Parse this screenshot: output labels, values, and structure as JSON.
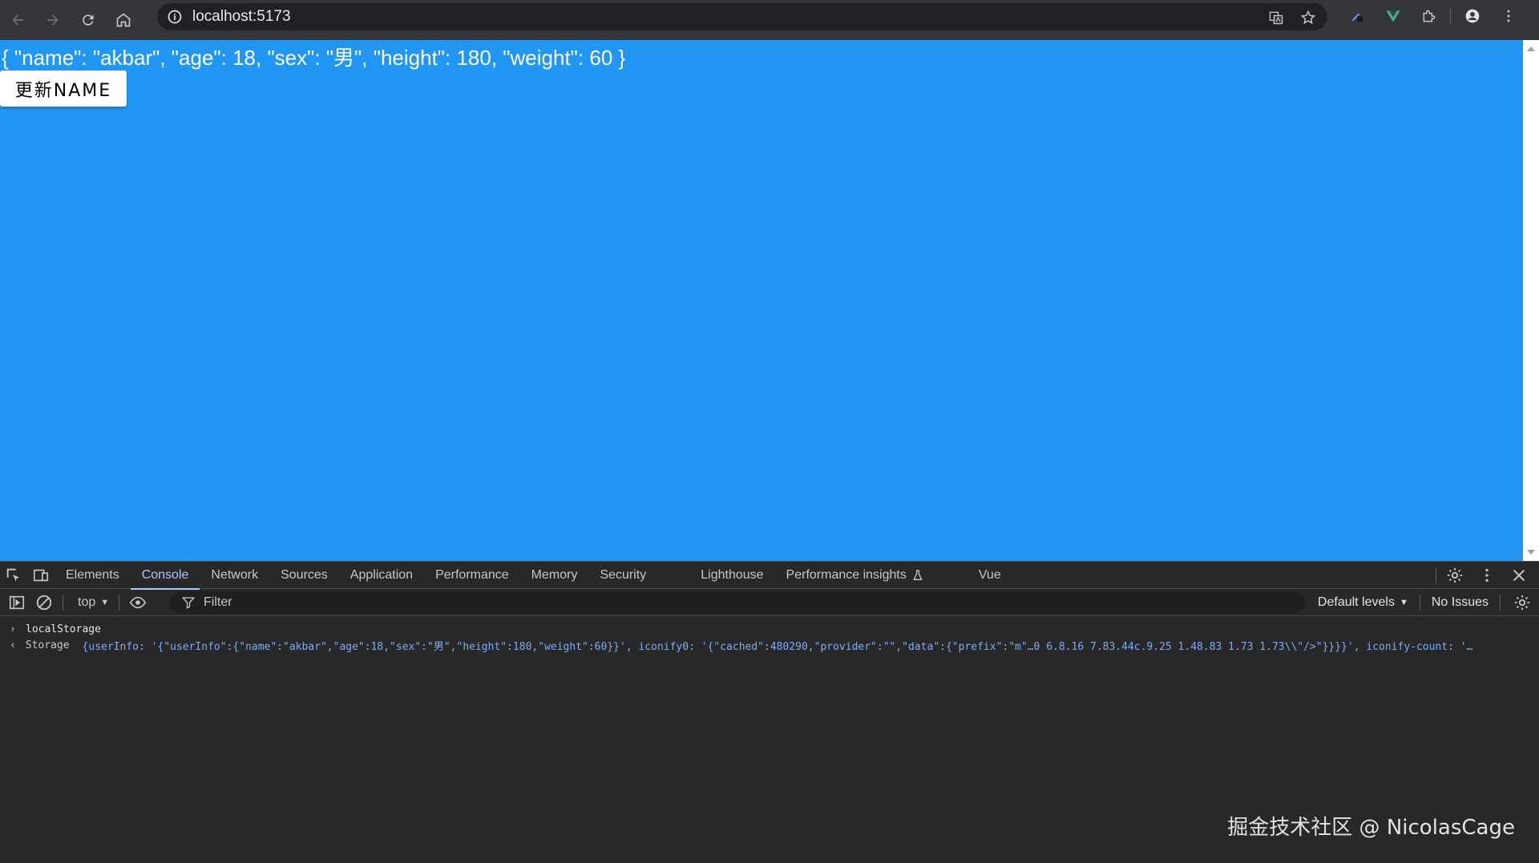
{
  "browser": {
    "url": "localhost:5173"
  },
  "page": {
    "json_text": "{ \"name\": \"akbar\", \"age\": 18, \"sex\": \"男\", \"height\": 180, \"weight\": 60 }",
    "update_button": "更新NAME",
    "background_color": "#2196f3"
  },
  "devtools": {
    "tabs": [
      "Elements",
      "Console",
      "Network",
      "Sources",
      "Application",
      "Performance",
      "Memory",
      "Security",
      "Lighthouse",
      "Performance insights",
      "Vue"
    ],
    "active_tab": "Console",
    "context": "top",
    "filter_placeholder": "Filter",
    "levels": "Default levels",
    "issues": "No Issues",
    "console": {
      "command": "localStorage",
      "result_label": "Storage",
      "result_value": "{userInfo: '{\"userInfo\":{\"name\":\"akbar\",\"age\":18,\"sex\":\"男\",\"height\":180,\"weight\":60}}', iconify0: '{\"cached\":480290,\"provider\":\"\",\"data\":{\"prefix\":\"m\"…0 6.8.16 7.83.44c.9.25 1.48.83 1.73 1.73\\\\\"/>\"}}}}', iconify-count: '…"
    }
  },
  "watermark": "掘金技术社区 @ NicolasCage"
}
